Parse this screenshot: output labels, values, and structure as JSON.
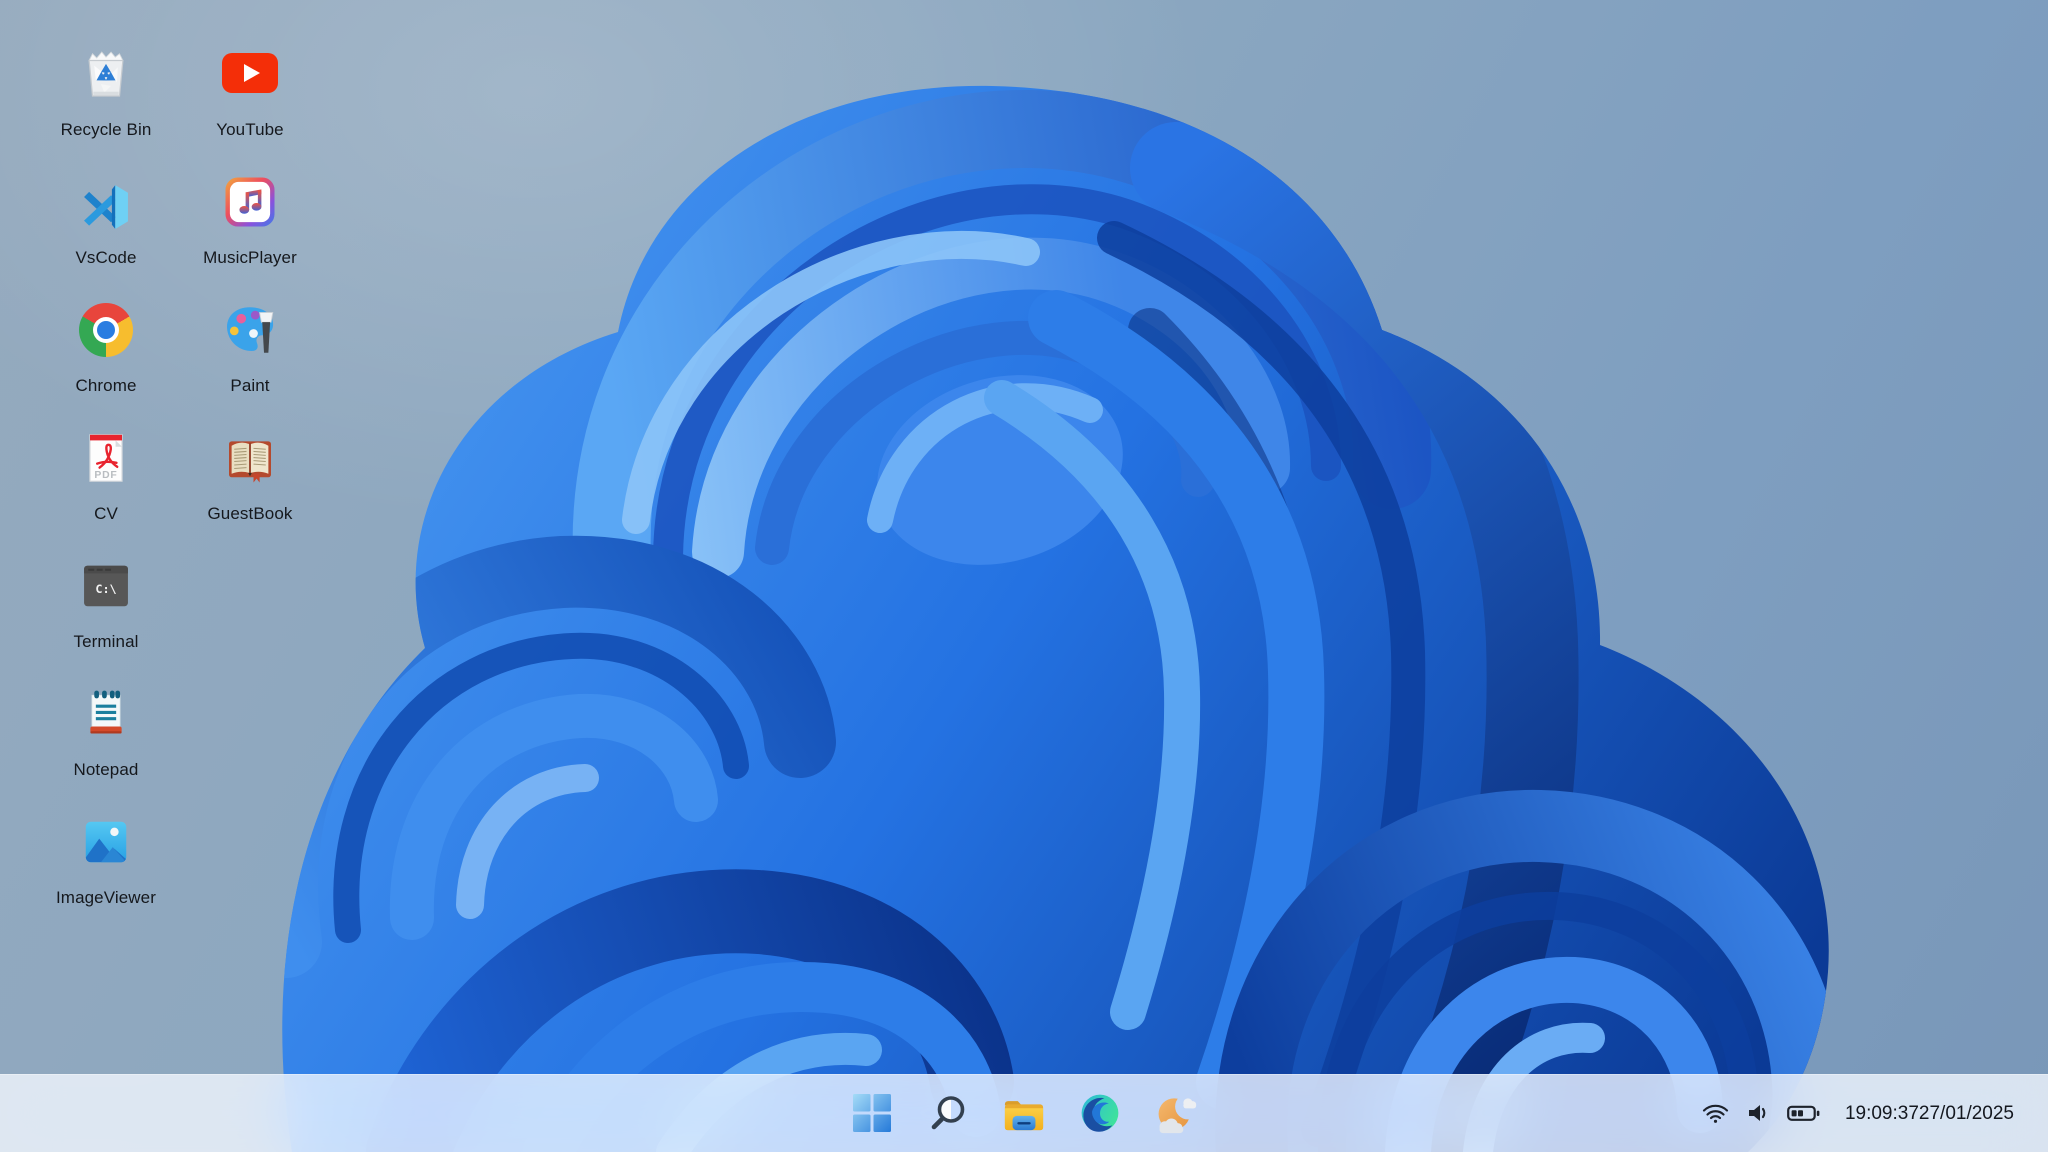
{
  "desktop": {
    "icons": [
      {
        "icon": "recycle-bin-icon",
        "label": "Recycle Bin"
      },
      {
        "icon": "youtube-icon",
        "label": "YouTube"
      },
      {
        "icon": "vscode-icon",
        "label": "VsCode"
      },
      {
        "icon": "music-player-icon",
        "label": "MusicPlayer"
      },
      {
        "icon": "chrome-icon",
        "label": "Chrome"
      },
      {
        "icon": "paint-icon",
        "label": "Paint"
      },
      {
        "icon": "pdf-document-icon",
        "label": "CV"
      },
      {
        "icon": "guestbook-icon",
        "label": "GuestBook"
      },
      {
        "icon": "terminal-icon",
        "label": "Terminal"
      },
      {
        "icon": "notepad-icon",
        "label": "Notepad"
      },
      {
        "icon": "image-viewer-icon",
        "label": "ImageViewer"
      }
    ],
    "icon_glyphs": {
      "terminal_prompt": "C:\\",
      "pdf_label": "PDF"
    }
  },
  "taskbar": {
    "buttons": [
      {
        "icon": "start-icon"
      },
      {
        "icon": "search-icon"
      },
      {
        "icon": "file-explorer-icon"
      },
      {
        "icon": "edge-browser-icon"
      },
      {
        "icon": "weather-moon-icon"
      }
    ],
    "tray": {
      "icons": [
        "wifi-icon",
        "volume-icon",
        "battery-icon"
      ],
      "time": "19:09:37",
      "date": "27/01/2025"
    }
  },
  "theme": {
    "sky-top": "#95aabe",
    "sky-right": "#7e9ec0",
    "taskbar-bg": "rgba(242,246,252,0.80)",
    "label-color": "#15181d",
    "tray-icon-color": "#1d222b",
    "bloom-dark": "#0b3a96",
    "bloom-mid": "#2472e2",
    "bloom-light": "#5aa7f4"
  }
}
